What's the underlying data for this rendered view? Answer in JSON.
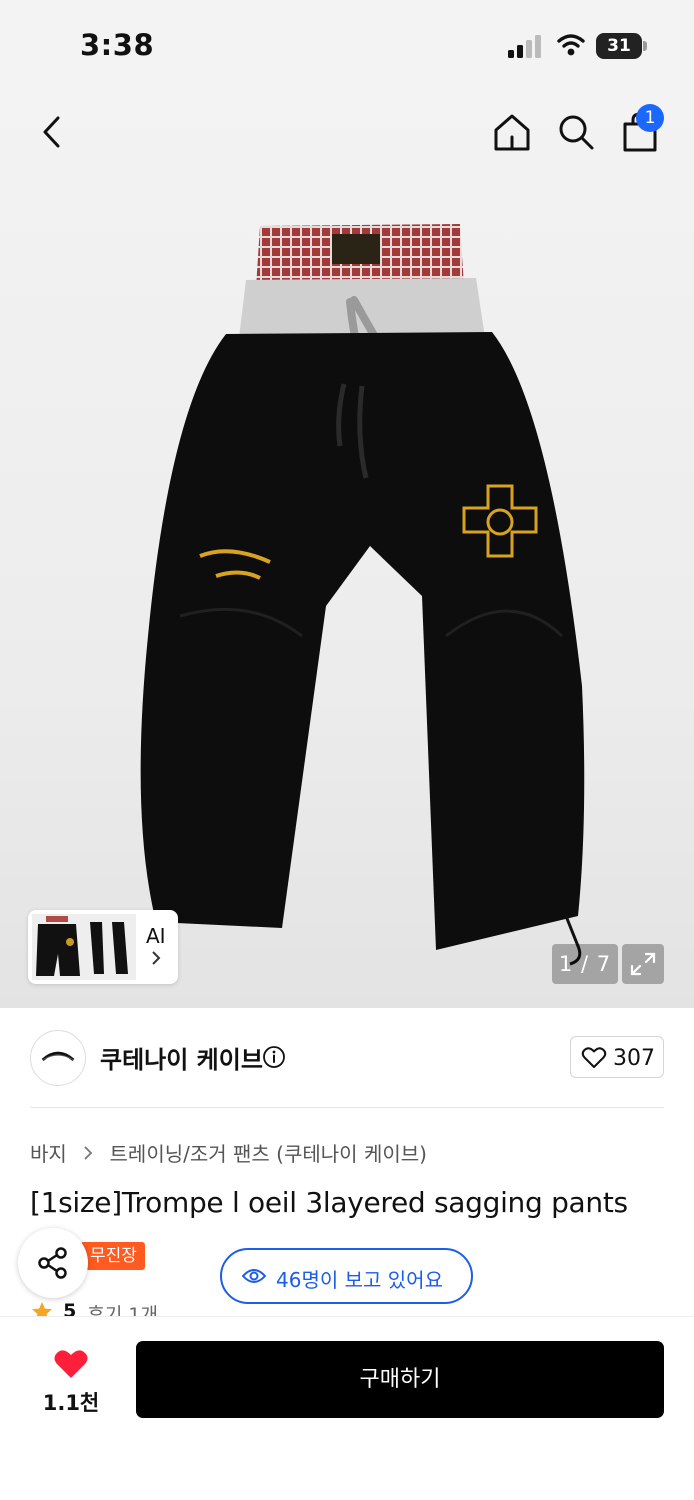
{
  "status_bar": {
    "time": "3:38",
    "battery": "31"
  },
  "nav": {
    "cart_count": "1"
  },
  "gallery": {
    "ai_label": "AI",
    "counter": "1 / 7"
  },
  "brand": {
    "name": "쿠테나이 케이브",
    "likes": "307"
  },
  "breadcrumb": {
    "category": "바지",
    "subcategory": "트레이닝/조거 팬츠 (쿠테나이 케이브)"
  },
  "product": {
    "title": "[1size]Trompe l oeil 3layered sagging pants",
    "badge": "무진장",
    "viewers": "46명이 보고 있어요",
    "rating": "5",
    "reviews": "후기 1개"
  },
  "bottom_bar": {
    "wish_count": "1.1천",
    "buy_label": "구매하기"
  },
  "colors": {
    "accent_blue": "#1c5dea",
    "badge_orange": "#ff5a1f",
    "heart_red": "#ff1f3a",
    "buy_black": "#000000"
  },
  "icons": [
    "back-icon",
    "home-icon",
    "search-icon",
    "shopping-bag-icon",
    "chevron-right-icon",
    "expand-icon",
    "info-icon",
    "heart-icon",
    "share-icon",
    "eye-icon",
    "star-icon"
  ]
}
